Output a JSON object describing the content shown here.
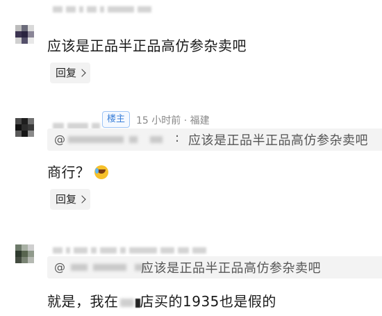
{
  "comments": [
    {
      "text": "应该是正品半正品高仿参杂卖吧",
      "reply_label": "回复"
    },
    {
      "op_badge": "楼主",
      "meta": "15 小时前 · 福建",
      "quote_at": "@",
      "quote_sep": ":",
      "quote_text": "应该是正品半正品高仿参杂卖吧",
      "text": "商行？",
      "emoji": "crying-laughing-emoji",
      "reply_label": "回复"
    },
    {
      "quote_at": "@",
      "quote_text": "应该是正品半正品高仿参杂卖吧",
      "text_part1": "就是，我在",
      "text_part2": "店买的1935也是假的"
    }
  ]
}
